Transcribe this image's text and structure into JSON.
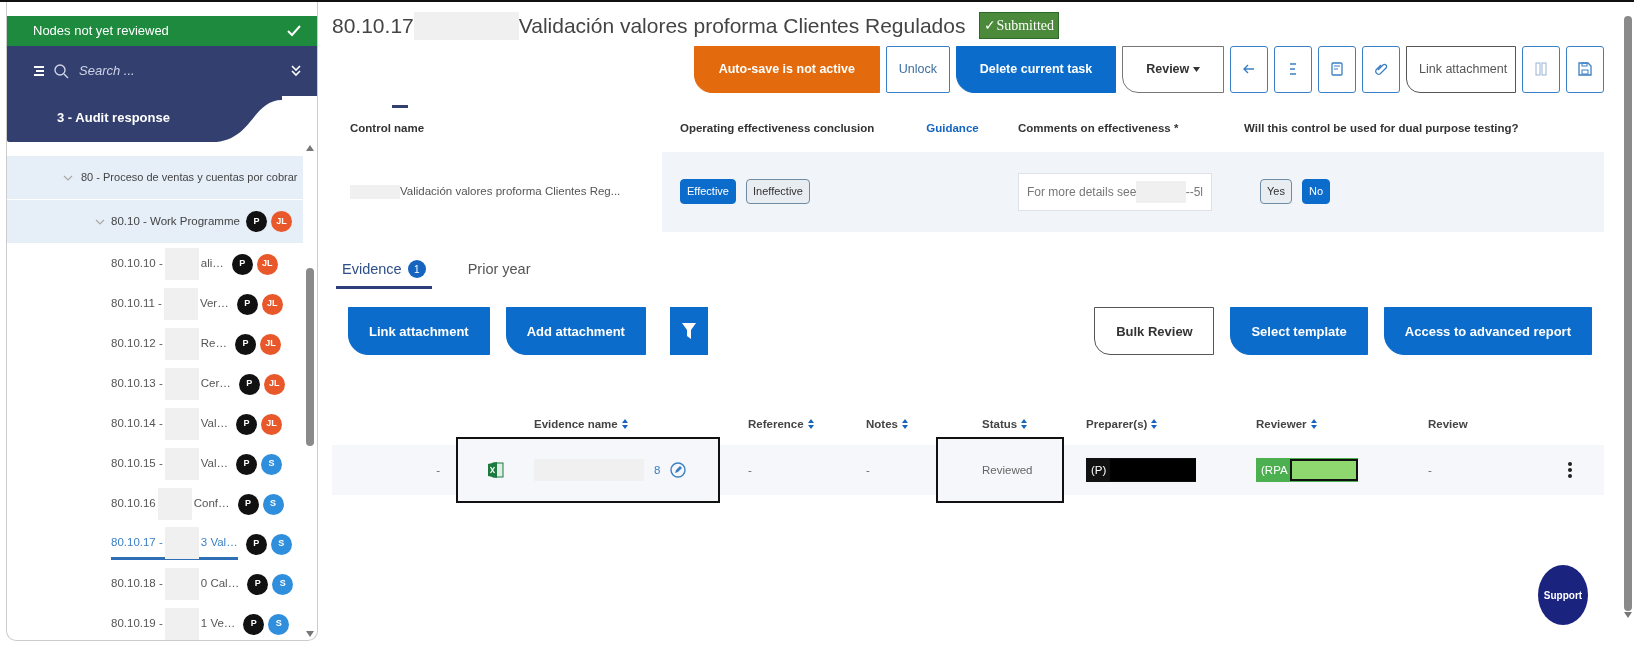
{
  "sidebar": {
    "filter_bar": {
      "label": "Nodes not yet reviewed",
      "checked": true
    },
    "search": {
      "placeholder": "Search ..."
    },
    "section_title": "3 - Audit response",
    "tree": [
      {
        "label": "80 - Proceso de ventas y cuentas por cobrar",
        "expanded": true,
        "children": [
          {
            "label": "80.10 - Work Programme",
            "expanded": true,
            "badges": [
              {
                "text": "P",
                "color": "#111111"
              },
              {
                "text": "JL",
                "color": "#e8582a"
              }
            ],
            "children": [
              {
                "code": "80.10.10 -",
                "tail": "ali…",
                "selected": false,
                "badges": [
                  {
                    "text": "P",
                    "color": "#111111"
                  },
                  {
                    "text": "JL",
                    "color": "#e8582a"
                  }
                ]
              },
              {
                "code": "80.10.11 -",
                "tail": "Ver…",
                "selected": false,
                "badges": [
                  {
                    "text": "P",
                    "color": "#111111"
                  },
                  {
                    "text": "JL",
                    "color": "#e8582a"
                  }
                ]
              },
              {
                "code": "80.10.12 -",
                "tail": "Re…",
                "selected": false,
                "badges": [
                  {
                    "text": "P",
                    "color": "#111111"
                  },
                  {
                    "text": "JL",
                    "color": "#e8582a"
                  }
                ]
              },
              {
                "code": "80.10.13 -",
                "tail": "Cer…",
                "selected": false,
                "badges": [
                  {
                    "text": "P",
                    "color": "#111111"
                  },
                  {
                    "text": "JL",
                    "color": "#e8582a"
                  }
                ]
              },
              {
                "code": "80.10.14 -",
                "tail": "Val…",
                "selected": false,
                "badges": [
                  {
                    "text": "P",
                    "color": "#111111"
                  },
                  {
                    "text": "JL",
                    "color": "#e8582a"
                  }
                ]
              },
              {
                "code": "80.10.15 -",
                "tail": "Val…",
                "selected": false,
                "badges": [
                  {
                    "text": "P",
                    "color": "#111111"
                  },
                  {
                    "text": "S",
                    "color": "#2f8fdd"
                  }
                ]
              },
              {
                "code": "80.10.16",
                "tail": "Conf…",
                "selected": false,
                "badges": [
                  {
                    "text": "P",
                    "color": "#111111"
                  },
                  {
                    "text": "S",
                    "color": "#2f8fdd"
                  }
                ]
              },
              {
                "code": "80.10.17 -",
                "tail": "3 Val…",
                "selected": true,
                "badges": [
                  {
                    "text": "P",
                    "color": "#111111"
                  },
                  {
                    "text": "S",
                    "color": "#2f8fdd"
                  }
                ]
              },
              {
                "code": "80.10.18 -",
                "tail": "0 Cal…",
                "selected": false,
                "badges": [
                  {
                    "text": "P",
                    "color": "#111111"
                  },
                  {
                    "text": "S",
                    "color": "#2f8fdd"
                  }
                ]
              },
              {
                "code": "80.10.19 -",
                "tail": "1 Ve…",
                "selected": false,
                "badges": [
                  {
                    "text": "P",
                    "color": "#111111"
                  },
                  {
                    "text": "S",
                    "color": "#2f8fdd"
                  }
                ]
              }
            ]
          }
        ]
      }
    ]
  },
  "header": {
    "code": "80.10.17",
    "title": "Validación valores proforma Clientes Regulados",
    "status": "✓Submitted"
  },
  "toolbar": [
    {
      "kind": "warning",
      "label": "Auto-save is not active"
    },
    {
      "kind": "outline",
      "label": "Unlock"
    },
    {
      "kind": "primary",
      "label": "Delete current task"
    },
    {
      "kind": "dropdown",
      "label": "Review"
    },
    {
      "kind": "icon"
    },
    {
      "kind": "icon"
    },
    {
      "kind": "icon"
    },
    {
      "kind": "icon"
    },
    {
      "kind": "outline",
      "label": "Link attachment"
    },
    {
      "kind": "icon"
    },
    {
      "kind": "icon"
    }
  ],
  "control": {
    "columns": [
      "Control name",
      "Operating effectiveness conclusion",
      "Comments on effectiveness *",
      "Will this control be used for dual purpose testing?"
    ],
    "guidance_link": "Guidance",
    "control_name": "Validación valores proforma Clientes Reg...",
    "conclusion": [
      {
        "label": "Effective",
        "selected": true
      },
      {
        "label": "Ineffective",
        "selected": false
      }
    ],
    "comments": {
      "start": "For more details see",
      "end": "--5l"
    },
    "dual_purpose": [
      {
        "label": "Yes",
        "selected": false
      },
      {
        "label": "No",
        "selected": true
      }
    ]
  },
  "tabs": [
    {
      "label": "Evidence",
      "count": "1",
      "selected": true
    },
    {
      "label": "Prior year",
      "selected": false
    }
  ],
  "actions_left": [
    {
      "kind": "primary",
      "label": "Link attachment"
    },
    {
      "kind": "primary",
      "label": "Add attachment"
    },
    {
      "kind": "filter"
    }
  ],
  "actions_right": [
    {
      "kind": "outline",
      "label": "Bulk Review"
    },
    {
      "kind": "primary",
      "label": "Select template"
    },
    {
      "kind": "primary",
      "label": "Access to advanced report"
    }
  ],
  "table": {
    "columns": [
      {
        "label": "Evidence name",
        "sortable": true
      },
      {
        "label": "Reference",
        "sortable": true
      },
      {
        "label": "Notes",
        "sortable": true
      },
      {
        "label": "Status",
        "sortable": true
      },
      {
        "label": "Preparer(s)",
        "sortable": true
      },
      {
        "label": "Reviewer",
        "sortable": true
      },
      {
        "label": "Review",
        "sortable": false
      }
    ],
    "rows": [
      {
        "column_1": "-",
        "evidence_name": {
          "tail": "8",
          "highlighted": true
        },
        "reference": "-",
        "notes": "-",
        "status": {
          "text": "Reviewed",
          "highlighted": true
        },
        "preparer": "(P)",
        "reviewer": "(RPA",
        "review": "-"
      }
    ]
  },
  "support_button": "Support"
}
